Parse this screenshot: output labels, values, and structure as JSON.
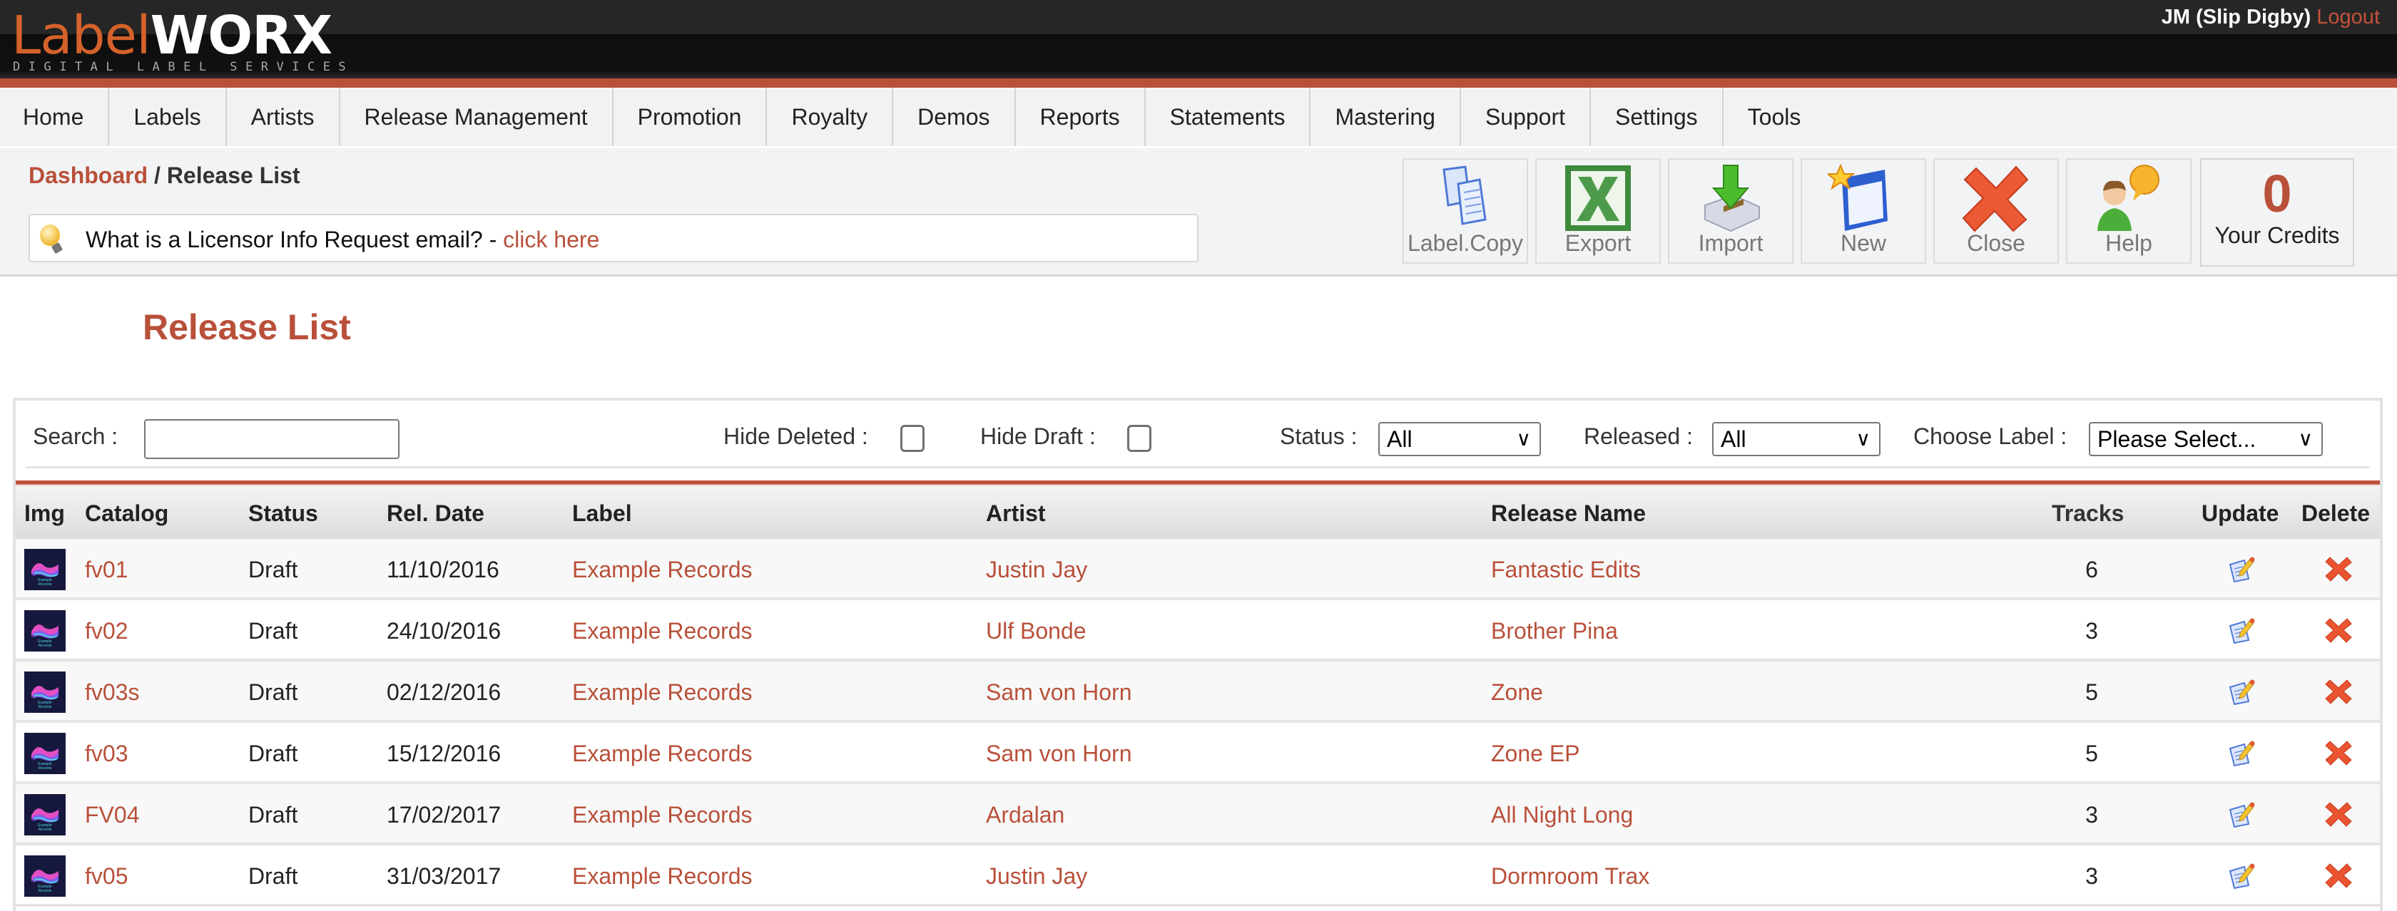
{
  "header": {
    "logo_part1": "Label",
    "logo_part2": "WORX",
    "logo_tagline": "DIGITAL LABEL SERVICES",
    "user": "JM (Slip Digby)",
    "logout": "Logout"
  },
  "nav": {
    "items": [
      {
        "label": "Home"
      },
      {
        "label": "Labels"
      },
      {
        "label": "Artists"
      },
      {
        "label": "Release Management"
      },
      {
        "label": "Promotion"
      },
      {
        "label": "Royalty"
      },
      {
        "label": "Demos"
      },
      {
        "label": "Reports"
      },
      {
        "label": "Statements"
      },
      {
        "label": "Mastering"
      },
      {
        "label": "Support"
      },
      {
        "label": "Settings"
      },
      {
        "label": "Tools"
      }
    ]
  },
  "breadcrumb": {
    "link": "Dashboard",
    "separator": " / ",
    "current": "Release List"
  },
  "tip": {
    "icon": "lightbulb-icon",
    "text": "What is a Licensor Info Request email? - ",
    "link": "click here"
  },
  "toolbar": {
    "buttons": [
      {
        "label": "Label.Copy",
        "icon": "copy-documents-icon"
      },
      {
        "label": "Export",
        "icon": "excel-icon"
      },
      {
        "label": "Import",
        "icon": "import-drive-icon"
      },
      {
        "label": "New",
        "icon": "new-window-icon"
      },
      {
        "label": "Close",
        "icon": "close-x-icon"
      },
      {
        "label": "Help",
        "icon": "help-person-icon"
      }
    ],
    "credits_value": "0",
    "credits_label": "Your Credits"
  },
  "page_title": "Release List",
  "filters": {
    "search_label": "Search :",
    "search_value": "",
    "hide_deleted_label": "Hide Deleted :",
    "hide_deleted_checked": false,
    "hide_draft_label": "Hide Draft :",
    "hide_draft_checked": false,
    "status_label": "Status :",
    "status_value": "All",
    "released_label": "Released :",
    "released_value": "All",
    "choose_label_label": "Choose Label :",
    "choose_label_value": "Please Select..."
  },
  "table": {
    "columns": {
      "img": "Img",
      "catalog": "Catalog",
      "status": "Status",
      "rel_date": "Rel. Date",
      "label": "Label",
      "artist": "Artist",
      "release_name": "Release Name",
      "tracks": "Tracks",
      "update": "Update",
      "delete": "Delete"
    },
    "rows": [
      {
        "catalog": "fv01",
        "status": "Draft",
        "rel_date": "11/10/2016",
        "label": "Example Records",
        "artist": "Justin Jay",
        "release_name": "Fantastic Edits",
        "tracks": "6"
      },
      {
        "catalog": "fv02",
        "status": "Draft",
        "rel_date": "24/10/2016",
        "label": "Example Records",
        "artist": "Ulf Bonde",
        "release_name": "Brother Pina",
        "tracks": "3"
      },
      {
        "catalog": "fv03s",
        "status": "Draft",
        "rel_date": "02/12/2016",
        "label": "Example Records",
        "artist": "Sam von Horn",
        "release_name": "Zone",
        "tracks": "5"
      },
      {
        "catalog": "fv03",
        "status": "Draft",
        "rel_date": "15/12/2016",
        "label": "Example Records",
        "artist": "Sam von Horn",
        "release_name": "Zone EP",
        "tracks": "5"
      },
      {
        "catalog": "FV04",
        "status": "Draft",
        "rel_date": "17/02/2017",
        "label": "Example Records",
        "artist": "Ardalan",
        "release_name": "All Night Long",
        "tracks": "3"
      },
      {
        "catalog": "fv05",
        "status": "Draft",
        "rel_date": "31/03/2017",
        "label": "Example Records",
        "artist": "Justin Jay",
        "release_name": "Dormroom Trax",
        "tracks": "3"
      }
    ],
    "thumb_text": "Example Records"
  },
  "colors": {
    "accent": "#b9503a",
    "logo_orange": "#d4622a"
  }
}
